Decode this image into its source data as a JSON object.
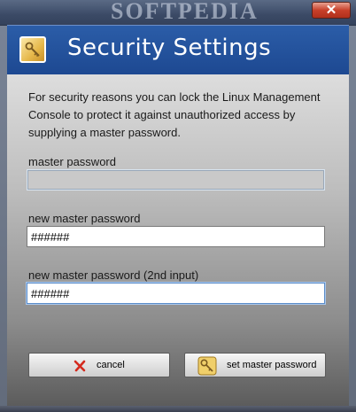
{
  "window": {
    "watermark": "SOFTPEDIA",
    "close_label": "✕"
  },
  "header": {
    "title": "Security Settings",
    "icon": "security-key-icon"
  },
  "description": "For security reasons you can lock the Linux Management Console to protect it against unauthorized access by supplying a master password.",
  "fields": {
    "master": {
      "label": "master password",
      "value": ""
    },
    "new": {
      "label": "new master password",
      "value": "######"
    },
    "confirm": {
      "label": "new master password (2nd input)",
      "value": "######"
    }
  },
  "buttons": {
    "cancel": {
      "label": "cancel",
      "icon": "red-x-icon"
    },
    "set": {
      "label": "set master password",
      "icon": "key-icon"
    }
  },
  "colors": {
    "header_blue": "#2b5da8",
    "cancel_icon_red": "#d42a1e"
  }
}
